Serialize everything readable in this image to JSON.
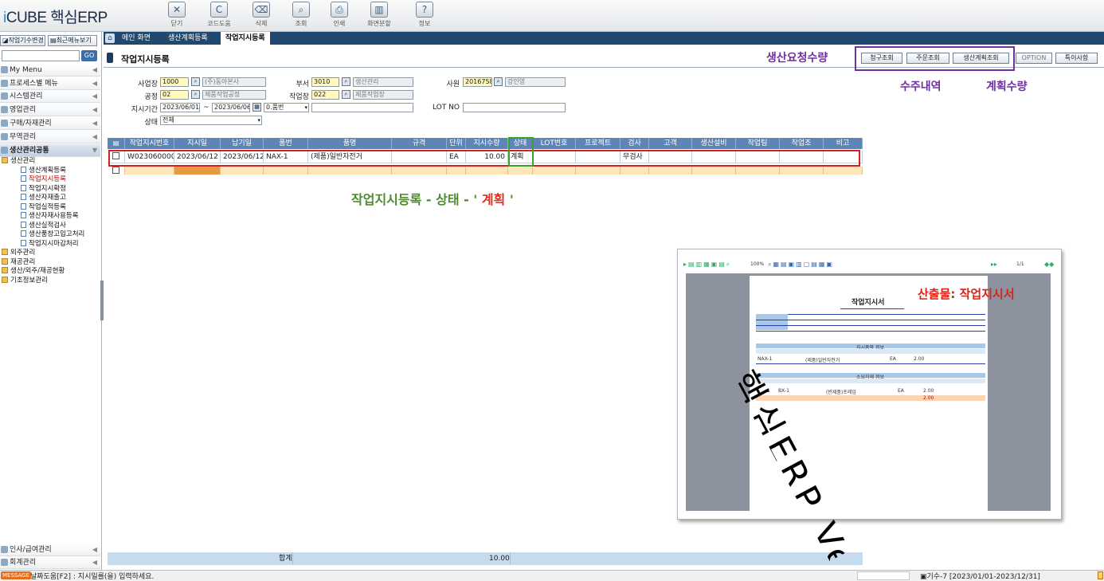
{
  "app": {
    "logo_prefix": "i",
    "logo_rest": "CUBE 핵심ERP"
  },
  "toolbar": [
    {
      "label": "닫기",
      "icon": "close-icon",
      "glyph": "✕"
    },
    {
      "label": "코드도움",
      "icon": "code-help-icon",
      "glyph": "C"
    },
    {
      "label": "삭제",
      "icon": "delete-icon",
      "glyph": "⌫"
    },
    {
      "label": "조회",
      "icon": "search-icon",
      "glyph": "⌕"
    },
    {
      "label": "인쇄",
      "icon": "print-icon",
      "glyph": "⎙"
    },
    {
      "label": "화면분할",
      "icon": "split-screen-icon",
      "glyph": "▥"
    },
    {
      "label": "정보",
      "icon": "info-icon",
      "glyph": "?"
    }
  ],
  "tabs": [
    {
      "label": "메인 화면"
    },
    {
      "label": "생산계획등록"
    },
    {
      "label": "작업지시등록",
      "active": true
    }
  ],
  "left": {
    "btn_change": "작업기수변경",
    "btn_recent": "최근메뉴보기",
    "search_value": "",
    "go": "GO",
    "menus": [
      "My Menu",
      "프로세스별 메뉴",
      "시스템관리",
      "영업관리",
      "구매/자재관리",
      "무역관리",
      "생산관리공통"
    ],
    "tree": [
      {
        "label": "생산관리",
        "type": "folder",
        "indent": 0
      },
      {
        "label": "생산계획등록",
        "type": "page",
        "indent": 2
      },
      {
        "label": "작업지시등록",
        "type": "page",
        "indent": 2,
        "current": true
      },
      {
        "label": "작업지시확정",
        "type": "page",
        "indent": 2
      },
      {
        "label": "생산자재출고",
        "type": "page",
        "indent": 2
      },
      {
        "label": "작업실적등록",
        "type": "page",
        "indent": 2
      },
      {
        "label": "생산자재사용등록",
        "type": "page",
        "indent": 2
      },
      {
        "label": "생산실적검사",
        "type": "page",
        "indent": 2
      },
      {
        "label": "생산품창고입고처리",
        "type": "page",
        "indent": 2
      },
      {
        "label": "작업지시마감처리",
        "type": "page",
        "indent": 2
      },
      {
        "label": "외주관리",
        "type": "folder",
        "indent": 0
      },
      {
        "label": "재공관리",
        "type": "folder",
        "indent": 0
      },
      {
        "label": "생산/외주/재공현황",
        "type": "folder",
        "indent": 0
      },
      {
        "label": "기초정보관리",
        "type": "folder",
        "indent": 0
      }
    ],
    "bottom_menus": [
      "인사/급여관리",
      "회계관리"
    ]
  },
  "page": {
    "title": "작업지시등록",
    "buttons": [
      "청구조회",
      "주문조회",
      "생산계획조회",
      "OPTION",
      "특이사항"
    ]
  },
  "annotations": {
    "request_qty": "생산요청수량",
    "order_history": "수주내역",
    "plan_qty": "계획수량",
    "caption_main": "작업지시등록 - 상태 - '",
    "caption_hl": "계획",
    "caption_end": "'",
    "output": "산출물: 작업지시서"
  },
  "form": {
    "biz_label": "사업장",
    "biz_code": "1000",
    "biz_name": "(주)동아본사",
    "dept_label": "부서",
    "dept_code": "3010",
    "dept_name": "생산관리",
    "emp_label": "사원",
    "emp_code": "2016758",
    "emp_name": "강인영",
    "proc_label": "공정",
    "proc_code": "02",
    "proc_name": "제품작업공정",
    "work_label": "작업장",
    "work_code": "022",
    "work_name": "제품작업장",
    "period_label": "지시기간",
    "period_from": "2023/06/01",
    "tilde": "~",
    "period_to": "2023/06/06",
    "item_sel": "0.품번",
    "item_val": "",
    "lot_label": "LOT NO",
    "lot_val": "",
    "status_label": "상태",
    "status_val": "전체"
  },
  "grid": {
    "headers": [
      "작업지시번호",
      "지시일",
      "납기일",
      "품번",
      "품명",
      "규격",
      "단위",
      "지시수량",
      "상태",
      "LOT번호",
      "프로젝트",
      "검사",
      "고객",
      "생산설비",
      "작업팀",
      "작업조",
      "비고"
    ],
    "rows": [
      [
        "W02306000002",
        "2023/06/12",
        "2023/06/12",
        "NAX-1",
        "(제품)일반자전거",
        "",
        "EA",
        "10.00",
        "계획",
        "",
        "",
        "무검사",
        "",
        "",
        "",
        "",
        ""
      ]
    ],
    "sum_label": "합계",
    "sum_value": "10.00"
  },
  "status": {
    "tag": "MESSAGE",
    "message": "날짜도움[F2] : 지시일를(을) 입력하세요.",
    "period": "기수-7 [2023/01/01-2023/12/31]"
  },
  "preview": {
    "page_indicator": "1/1",
    "zoom": "100%",
    "report_title": "작업지시서",
    "band1": "지시품목 정보",
    "band2": "소요자재 정보",
    "row1_item": "NAX-1",
    "row1_name": "(제품)일반자전거",
    "row1_unit": "EA",
    "row1_qty": "2.00",
    "row2_no": "1",
    "row2_item": "BX-1",
    "row2_name": "(반제품)프레임",
    "row2_unit": "EA",
    "row2_qty": "2.00",
    "row2_total": "2.00",
    "watermark": "핵심ERP Ve"
  }
}
